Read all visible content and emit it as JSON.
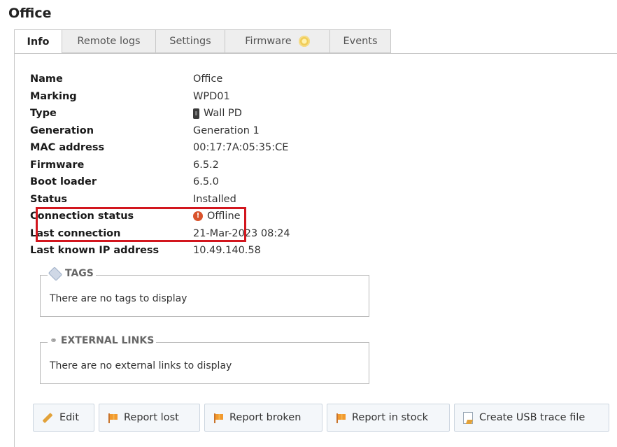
{
  "page": {
    "title": "Office"
  },
  "tabs": [
    {
      "label": "Info",
      "active": true
    },
    {
      "label": "Remote logs"
    },
    {
      "label": "Settings"
    },
    {
      "label": "Firmware",
      "icon": "gear-icon"
    },
    {
      "label": "Events"
    }
  ],
  "properties": [
    {
      "label": "Name",
      "value": "Office"
    },
    {
      "label": "Marking",
      "value": "WPD01"
    },
    {
      "label": "Type",
      "value": "Wall PD",
      "icon": "phone-icon"
    },
    {
      "label": "Generation",
      "value": "Generation 1"
    },
    {
      "label": "MAC address",
      "value": "00:17:7A:05:35:CE"
    },
    {
      "label": "Firmware",
      "value": "6.5.2"
    },
    {
      "label": "Boot loader",
      "value": "6.5.0"
    },
    {
      "label": "Status",
      "value": "Installed"
    },
    {
      "label": "Connection status",
      "value": "Offline",
      "icon": "offline-icon"
    },
    {
      "label": "Last connection",
      "value": "21-Mar-2023 08:24"
    },
    {
      "label": "Last known IP address",
      "value": "10.49.140.58"
    }
  ],
  "tags": {
    "legend": "TAGS",
    "empty_text": "There are no tags to display"
  },
  "external_links": {
    "legend": "EXTERNAL LINKS",
    "empty_text": "There are no external links to display"
  },
  "buttons": {
    "edit": "Edit",
    "report_lost": "Report lost",
    "report_broken": "Report broken",
    "report_in_stock": "Report in stock",
    "create_usb_trace": "Create USB trace file"
  },
  "colors": {
    "highlight": "#d2161e",
    "offline": "#d9532c",
    "tab_bg": "#eeeeee",
    "button_bg": "#f4f7fa"
  }
}
